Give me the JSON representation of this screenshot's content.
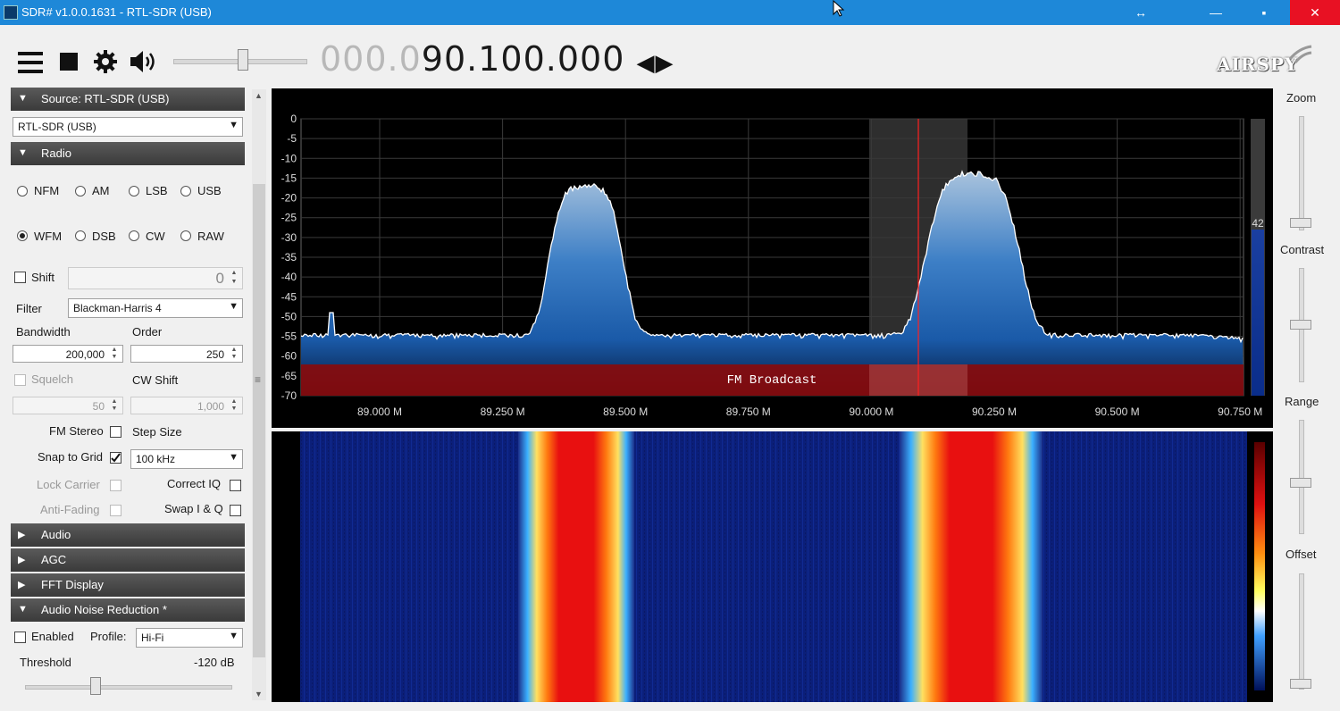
{
  "window": {
    "title": "SDR# v1.0.0.1631 - RTL-SDR (USB)",
    "min": "—",
    "max": "▪",
    "close": "✕",
    "resize": "↔"
  },
  "toolbar": {
    "menu_icon": "hamburger-icon",
    "stop_icon": "stop-icon",
    "settings_icon": "gear-icon",
    "volume_icon": "speaker-icon",
    "volume_level": 0.55
  },
  "frequency": {
    "dim_part": "000.0",
    "bright_part": "90.100.000",
    "arrows": "◀▶"
  },
  "logo": "AIRSPY",
  "source": {
    "header": "Source: RTL-SDR (USB)",
    "selected": "RTL-SDR (USB)"
  },
  "radio": {
    "header": "Radio",
    "modes": [
      "NFM",
      "AM",
      "LSB",
      "USB",
      "WFM",
      "DSB",
      "CW",
      "RAW"
    ],
    "selected_mode": "WFM",
    "shift_label": "Shift",
    "shift_value": "0",
    "filter_label": "Filter",
    "filter_value": "Blackman-Harris 4",
    "bandwidth_label": "Bandwidth",
    "bandwidth_value": "200,000",
    "order_label": "Order",
    "order_value": "250",
    "squelch_label": "Squelch",
    "squelch_value": "50",
    "cwshift_label": "CW Shift",
    "cwshift_value": "1,000",
    "fmstereo_label": "FM Stereo",
    "stepsize_label": "Step Size",
    "snap_label": "Snap to Grid",
    "snap_checked": true,
    "step_value": "100 kHz",
    "lockcarrier_label": "Lock Carrier",
    "correctiq_label": "Correct IQ",
    "antifading_label": "Anti-Fading",
    "swapiq_label": "Swap I & Q"
  },
  "sections": {
    "audio": "Audio",
    "agc": "AGC",
    "fft": "FFT Display",
    "anr": "Audio Noise Reduction *"
  },
  "anr": {
    "enabled_label": "Enabled",
    "profile_label": "Profile:",
    "profile_value": "Hi-Fi",
    "threshold_label": "Threshold",
    "threshold_value": "-120 dB"
  },
  "spectrum": {
    "y_ticks": [
      "0",
      "-5",
      "-10",
      "-15",
      "-20",
      "-25",
      "-30",
      "-35",
      "-40",
      "-45",
      "-50",
      "-55",
      "-60",
      "-65",
      "-70"
    ],
    "x_ticks": [
      "89.000 M",
      "89.250 M",
      "89.500 M",
      "89.750 M",
      "90.000 M",
      "90.250 M",
      "90.500 M",
      "90.750 M"
    ],
    "band_label": "FM Broadcast",
    "level_value": "42",
    "colors": {
      "band": "#8b0a0a",
      "trace": "#ffffff",
      "fill": "#1f6fc2",
      "center": "#ff2020"
    }
  },
  "right": {
    "zoom": "Zoom",
    "contrast": "Contrast",
    "range": "Range",
    "offset": "Offset"
  }
}
